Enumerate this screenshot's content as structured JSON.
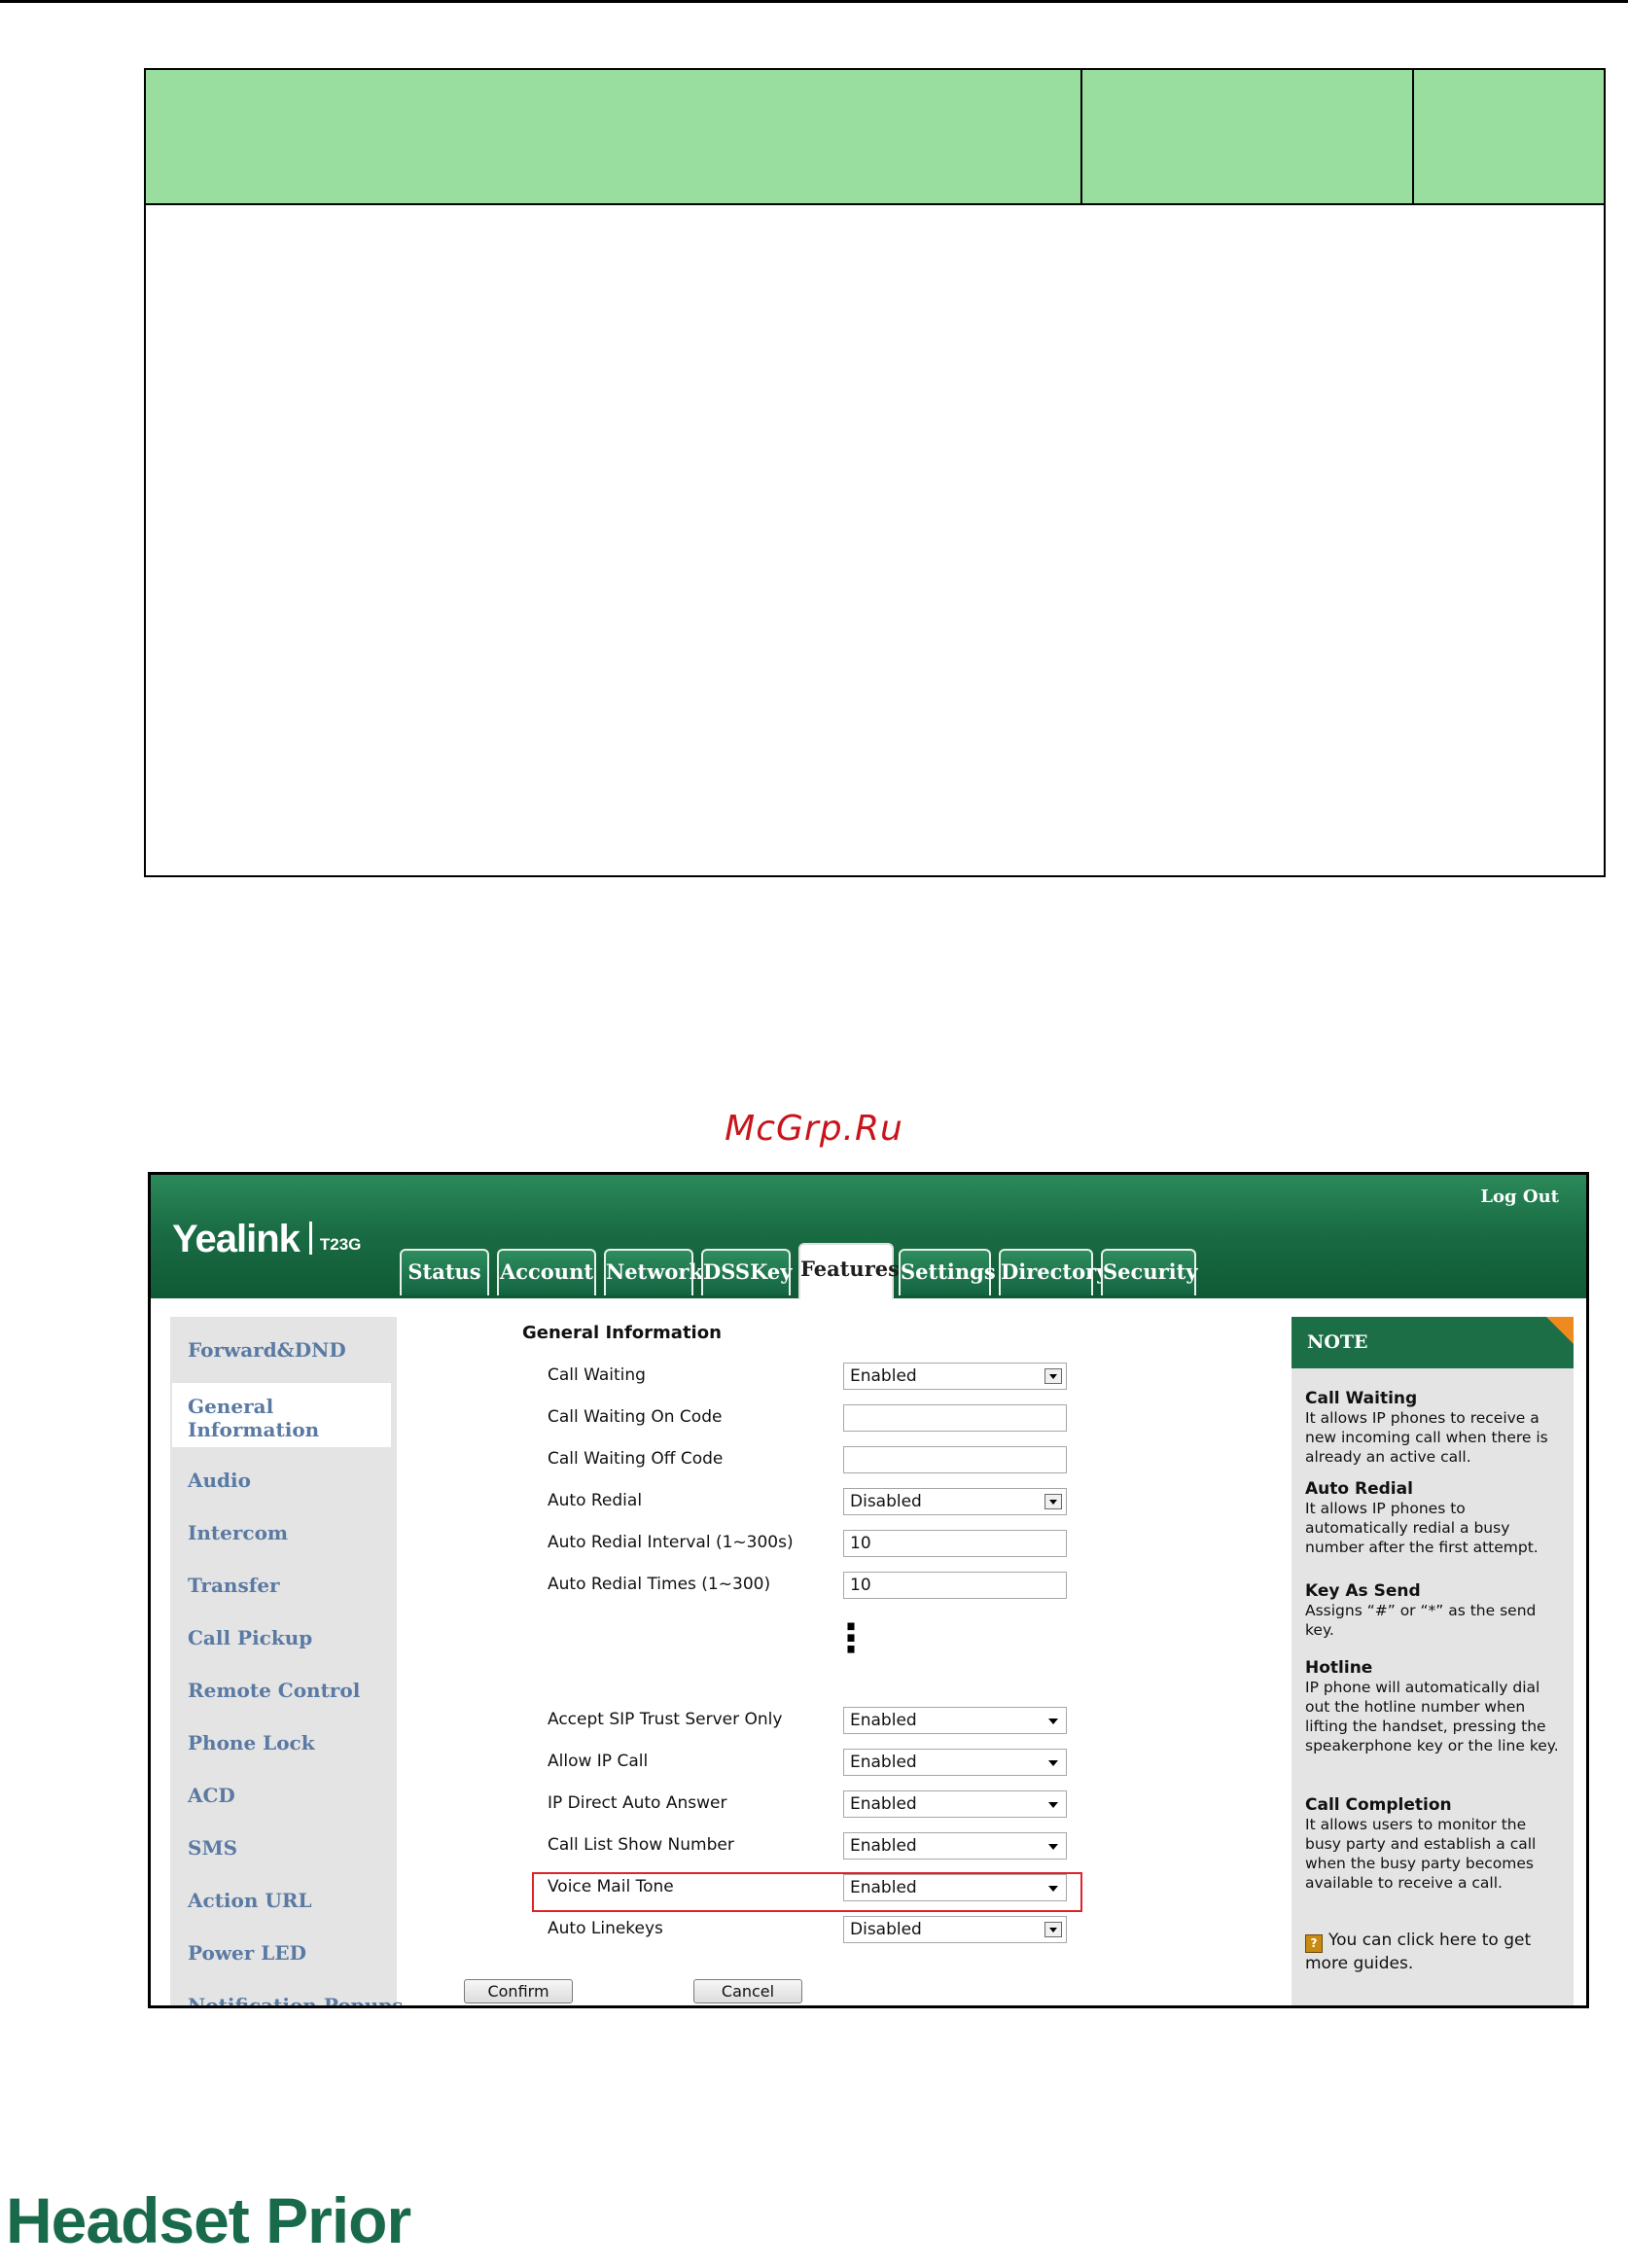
{
  "watermark": "McGrp.Ru",
  "screenshot": {
    "logo": "Yealink",
    "model": "T23G",
    "logout": "Log Out",
    "tabs": [
      "Status",
      "Account",
      "Network",
      "DSSKey",
      "Features",
      "Settings",
      "Directory",
      "Security"
    ],
    "active_tab": "Features",
    "sidebar": [
      "Forward&DND",
      "General Information",
      "Audio",
      "Intercom",
      "Transfer",
      "Call Pickup",
      "Remote Control",
      "Phone Lock",
      "ACD",
      "SMS",
      "Action URL",
      "Power LED",
      "Notification Popups"
    ],
    "active_sidebar": "General Information",
    "section_title": "General Information",
    "rows_top": [
      {
        "label": "Call Waiting",
        "value": "Enabled",
        "type": "select"
      },
      {
        "label": "Call Waiting On Code",
        "value": "",
        "type": "text"
      },
      {
        "label": "Call Waiting Off Code",
        "value": "",
        "type": "text"
      },
      {
        "label": "Auto Redial",
        "value": "Disabled",
        "type": "select"
      },
      {
        "label": "Auto Redial Interval (1~300s)",
        "value": "10",
        "type": "text"
      },
      {
        "label": "Auto Redial Times (1~300)",
        "value": "10",
        "type": "text"
      }
    ],
    "ellipsis": "⋮",
    "rows_bottom": [
      {
        "label": "Accept SIP Trust Server Only",
        "value": "Enabled",
        "type": "select"
      },
      {
        "label": "Allow IP Call",
        "value": "Enabled",
        "type": "select"
      },
      {
        "label": "IP Direct Auto Answer",
        "value": "Enabled",
        "type": "select"
      },
      {
        "label": "Call List Show Number",
        "value": "Enabled",
        "type": "select"
      },
      {
        "label": "Voice Mail Tone",
        "value": "Enabled",
        "type": "select"
      },
      {
        "label": "Auto Linekeys",
        "value": "Disabled",
        "type": "select"
      }
    ],
    "confirm_label": "Confirm",
    "cancel_label": "Cancel",
    "note": {
      "header": "NOTE",
      "items": [
        {
          "title": "Call Waiting",
          "text": "It allows IP phones to receive a new incoming call when there is already an active call."
        },
        {
          "title": "Auto Redial",
          "text": "It allows IP phones to automatically redial a busy number after the first attempt."
        },
        {
          "title": "Key As Send",
          "text": "Assigns “#” or “*” as the send key."
        },
        {
          "title": "Hotline",
          "text": "IP phone will automatically dial out the hotline number when lifting the handset, pressing the speakerphone key or the line key."
        },
        {
          "title": "Call Completion",
          "text": "It allows users to monitor the busy party and establish a call when the busy party becomes available to receive a call."
        }
      ],
      "guide_icon": "?",
      "guide_text": "You can click here to get more guides."
    }
  },
  "section_heading": "Headset Prior",
  "colors": {
    "table_header": "#99dd9f",
    "yealink_green": "#1a6c44",
    "highlight": "#e0232a",
    "heading": "#186a4a"
  }
}
